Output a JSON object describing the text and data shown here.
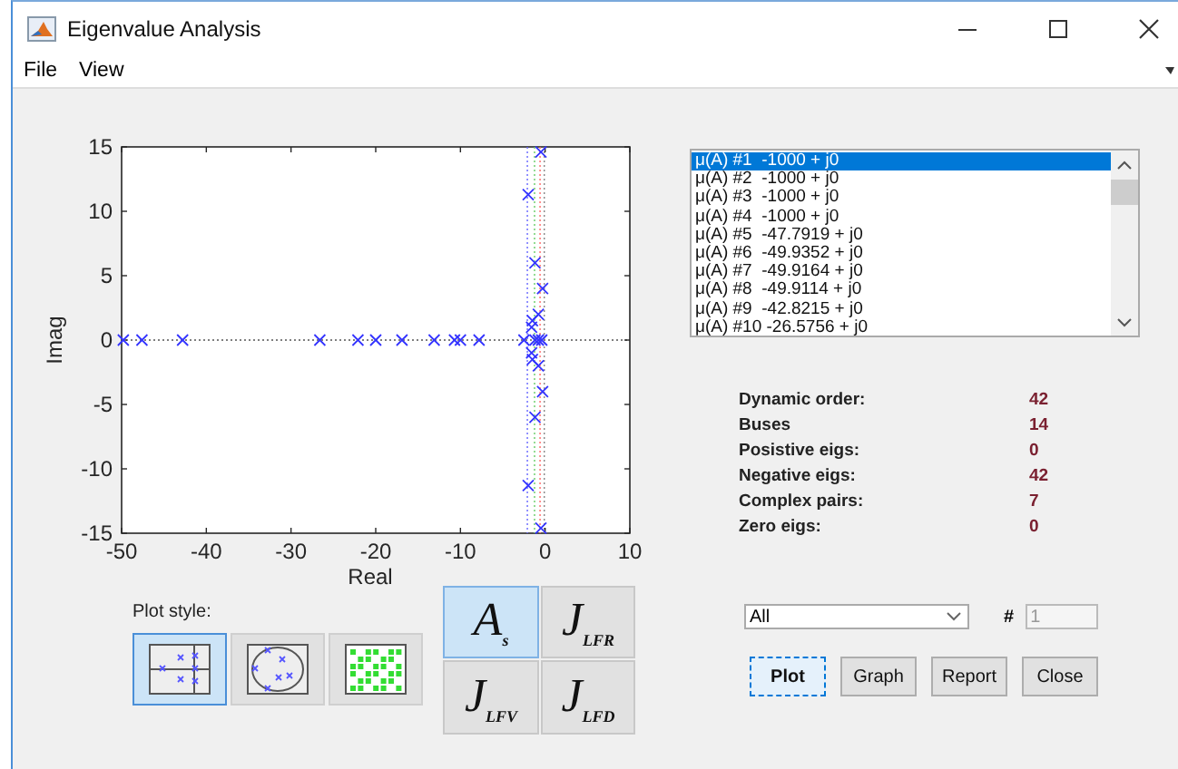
{
  "window": {
    "title": "Eigenvalue Analysis"
  },
  "menu": [
    "File",
    "View"
  ],
  "plot": {
    "chart_data": {
      "type": "scatter",
      "xlabel": "Real",
      "ylabel": "Imag",
      "xlim": [
        -50,
        10
      ],
      "ylim": [
        -15,
        15
      ],
      "xticks": [
        -50,
        -40,
        -30,
        -20,
        -10,
        0,
        10
      ],
      "yticks": [
        -15,
        -10,
        -5,
        0,
        5,
        10,
        15
      ],
      "x": [
        -49.8,
        -47.6,
        -42.8,
        -26.6,
        -22.1,
        -20,
        -16.9,
        -13.1,
        -10.7,
        -10,
        -7.8,
        -2.5,
        -1.2,
        -0.8,
        -0.4,
        -0.5,
        -0.5,
        -2,
        -2,
        -1.2,
        -1.2,
        -0.3,
        -0.3,
        -0.8,
        -0.8,
        -1.5,
        -1.5,
        -1.6,
        -1.6
      ],
      "ref_lines": [
        {
          "axis": "y",
          "value": 0,
          "color": "#555555"
        },
        {
          "axis": "x",
          "value": -2.1,
          "color": "#6666ff"
        },
        {
          "axis": "x",
          "value": -1.25,
          "color": "#66cc66"
        },
        {
          "axis": "x",
          "value": -0.6,
          "color": "#ff6666"
        },
        {
          "axis": "x",
          "value": -0.1,
          "color": "#888888"
        }
      ],
      "series": [
        {
          "color": "#3333ff",
          "values": [
            0,
            0,
            0,
            0,
            0,
            0,
            0,
            0,
            0,
            0,
            0,
            0,
            0,
            0,
            0,
            14.6,
            -14.6,
            11.3,
            -11.3,
            6,
            -6,
            4,
            -4,
            2,
            -2,
            1.5,
            -1.5,
            1,
            -1
          ]
        }
      ]
    }
  },
  "eigenvalues": [
    {
      "text": "μ(A) #1  -1000 + j0",
      "selected": true
    },
    {
      "text": "μ(A) #2  -1000 + j0",
      "selected": false
    },
    {
      "text": "μ(A) #3  -1000 + j0",
      "selected": false
    },
    {
      "text": "μ(A) #4  -1000 + j0",
      "selected": false
    },
    {
      "text": "μ(A) #5  -47.7919 + j0",
      "selected": false
    },
    {
      "text": "μ(A) #6  -49.9352 + j0",
      "selected": false
    },
    {
      "text": "μ(A) #7  -49.9164 + j0",
      "selected": false
    },
    {
      "text": "μ(A) #8  -49.9114 + j0",
      "selected": false
    },
    {
      "text": "μ(A) #9  -42.8215 + j0",
      "selected": false
    },
    {
      "text": "μ(A) #10 -26.5756 + j0",
      "selected": false
    }
  ],
  "stats": [
    {
      "label": "Dynamic order:",
      "value": "42"
    },
    {
      "label": "Buses",
      "value": "14"
    },
    {
      "label": "Posistive eigs:",
      "value": "0"
    },
    {
      "label": "Negative eigs:",
      "value": "42"
    },
    {
      "label": "Complex pairs:",
      "value": "7"
    },
    {
      "label": "Zero eigs:",
      "value": "0"
    }
  ],
  "plot_style": {
    "label": "Plot style:",
    "options": [
      {
        "kind": "axes",
        "selected": true
      },
      {
        "kind": "circle",
        "selected": false
      },
      {
        "kind": "grid",
        "selected": false
      }
    ]
  },
  "matrices": [
    {
      "label": "A$_{s}$",
      "selected": true
    },
    {
      "label": "J$_{LFR}$",
      "selected": false
    },
    {
      "label": "J$_{LFV}$",
      "selected": false
    },
    {
      "label": "J$_{LFD}$",
      "selected": false
    }
  ],
  "filter": {
    "value": "All"
  },
  "index": {
    "label": "#",
    "value": "1",
    "disabled": true
  },
  "buttons": [
    {
      "label": "Plot",
      "selected": true
    },
    {
      "label": "Graph",
      "selected": false
    },
    {
      "label": "Report",
      "selected": false
    },
    {
      "label": "Close",
      "selected": false
    }
  ]
}
